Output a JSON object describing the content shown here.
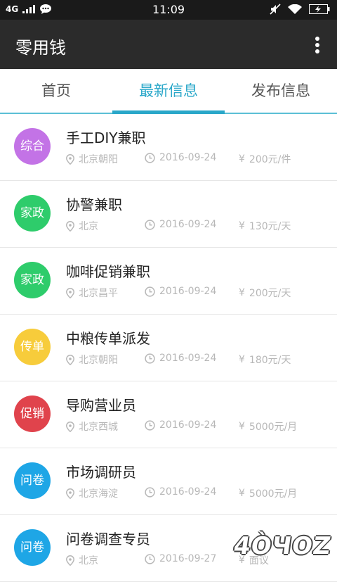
{
  "status_bar": {
    "network": "4G",
    "time": "11:09"
  },
  "app_bar": {
    "title": "零用钱"
  },
  "tabs": [
    {
      "label": "首页",
      "active": false
    },
    {
      "label": "最新信息",
      "active": true
    },
    {
      "label": "发布信息",
      "active": false
    }
  ],
  "colors": {
    "accent": "#29a7c9",
    "appbar": "#2b2b2b",
    "meta_text": "#b7b7b7"
  },
  "listings": [
    {
      "badge": "综合",
      "badge_color": "#c373e6",
      "title": "手工DIY兼职",
      "location": "北京朝阳",
      "date": "2016-09-24",
      "price": "200元/件"
    },
    {
      "badge": "家政",
      "badge_color": "#2ecc6b",
      "title": "协警兼职",
      "location": "北京",
      "date": "2016-09-24",
      "price": "130元/天"
    },
    {
      "badge": "家政",
      "badge_color": "#2ecc6b",
      "title": "咖啡促销兼职",
      "location": "北京昌平",
      "date": "2016-09-24",
      "price": "200元/天"
    },
    {
      "badge": "传单",
      "badge_color": "#f7cc3b",
      "title": "中粮传单派发",
      "location": "北京朝阳",
      "date": "2016-09-24",
      "price": "180元/天"
    },
    {
      "badge": "促销",
      "badge_color": "#e0434c",
      "title": "导购营业员",
      "location": "北京西城",
      "date": "2016-09-24",
      "price": "5000元/月"
    },
    {
      "badge": "问卷",
      "badge_color": "#1ea6e6",
      "title": "市场调研员",
      "location": "北京海淀",
      "date": "2016-09-24",
      "price": "5000元/月"
    },
    {
      "badge": "问卷",
      "badge_color": "#1ea6e6",
      "title": "问卷调查专员",
      "location": "北京",
      "date": "2016-09-27",
      "price": "面议"
    }
  ],
  "watermark": "4ÒЧOZ"
}
